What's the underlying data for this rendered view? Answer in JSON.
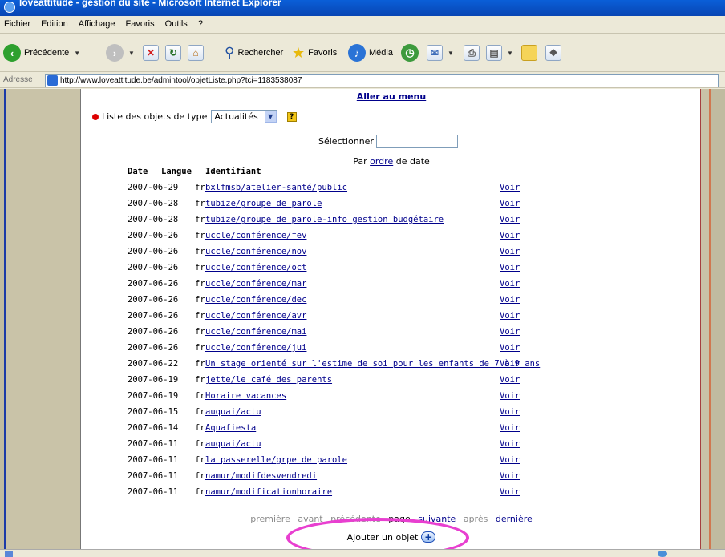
{
  "window": {
    "title": "loveattitude - gestion du site - Microsoft Internet Explorer"
  },
  "menubar": {
    "items": [
      "Fichier",
      "Edition",
      "Affichage",
      "Favoris",
      "Outils",
      "?"
    ]
  },
  "toolbar": {
    "back_label": "Précédente",
    "search_label": "Rechercher",
    "favorites_label": "Favoris",
    "media_label": "Média"
  },
  "address": {
    "label": "Adresse",
    "url": "http://www.loveattitude.be/admintool/objetListe.php?tci=1183538087"
  },
  "page": {
    "menu_link": "Aller au menu",
    "type_label": "Liste des objets de type",
    "type_value": "Actualités",
    "help_icon": "?",
    "select_label": "Sélectionner",
    "select_value": "",
    "sort_prefix": "Par",
    "sort_link": "ordre",
    "sort_suffix": "de date",
    "columns": {
      "date": "Date",
      "lang": "Langue",
      "id": "Identifiant"
    },
    "rows": [
      {
        "date": "2007-06-29",
        "lang": "fr",
        "id": "bxlfmsb/atelier-santé/public",
        "action": "Voir"
      },
      {
        "date": "2007-06-28",
        "lang": "fr",
        "id": "tubize/groupe de parole",
        "action": "Voir"
      },
      {
        "date": "2007-06-28",
        "lang": "fr",
        "id": "tubize/groupe de parole-info gestion budgétaire",
        "action": "Voir"
      },
      {
        "date": "2007-06-26",
        "lang": "fr",
        "id": "uccle/conférence/fev",
        "action": "Voir"
      },
      {
        "date": "2007-06-26",
        "lang": "fr",
        "id": "uccle/conférence/nov",
        "action": "Voir"
      },
      {
        "date": "2007-06-26",
        "lang": "fr",
        "id": "uccle/conférence/oct",
        "action": "Voir"
      },
      {
        "date": "2007-06-26",
        "lang": "fr",
        "id": "uccle/conférence/mar",
        "action": "Voir"
      },
      {
        "date": "2007-06-26",
        "lang": "fr",
        "id": "uccle/conférence/dec",
        "action": "Voir"
      },
      {
        "date": "2007-06-26",
        "lang": "fr",
        "id": "uccle/conférence/avr",
        "action": "Voir"
      },
      {
        "date": "2007-06-26",
        "lang": "fr",
        "id": "uccle/conférence/mai",
        "action": "Voir"
      },
      {
        "date": "2007-06-26",
        "lang": "fr",
        "id": "uccle/conférence/jui",
        "action": "Voir"
      },
      {
        "date": "2007-06-22",
        "lang": "fr",
        "id": "Un stage orienté sur l'estime de soi pour les enfants de 7 à 9 ans",
        "action": "Voir"
      },
      {
        "date": "2007-06-19",
        "lang": "fr",
        "id": "jette/le café des parents",
        "action": "Voir"
      },
      {
        "date": "2007-06-19",
        "lang": "fr",
        "id": "Horaire vacances",
        "action": "Voir"
      },
      {
        "date": "2007-06-15",
        "lang": "fr",
        "id": "auquai/actu",
        "action": "Voir"
      },
      {
        "date": "2007-06-14",
        "lang": "fr",
        "id": "Aquafiesta",
        "action": "Voir"
      },
      {
        "date": "2007-06-11",
        "lang": "fr",
        "id": "auquai/actu",
        "action": "Voir"
      },
      {
        "date": "2007-06-11",
        "lang": "fr",
        "id": "la passerelle/grpe de parole",
        "action": "Voir"
      },
      {
        "date": "2007-06-11",
        "lang": "fr",
        "id": "namur/modifdesvendredi",
        "action": "Voir"
      },
      {
        "date": "2007-06-11",
        "lang": "fr",
        "id": "namur/modificationhoraire",
        "action": "Voir"
      }
    ],
    "pager": {
      "first": "première",
      "prev": "avant",
      "prev_page": "précédente",
      "page": "page",
      "next_page": "suivante",
      "next": "après",
      "last": "dernière"
    },
    "add_label": "Ajouter un objet",
    "add_icon": "plus-icon"
  }
}
